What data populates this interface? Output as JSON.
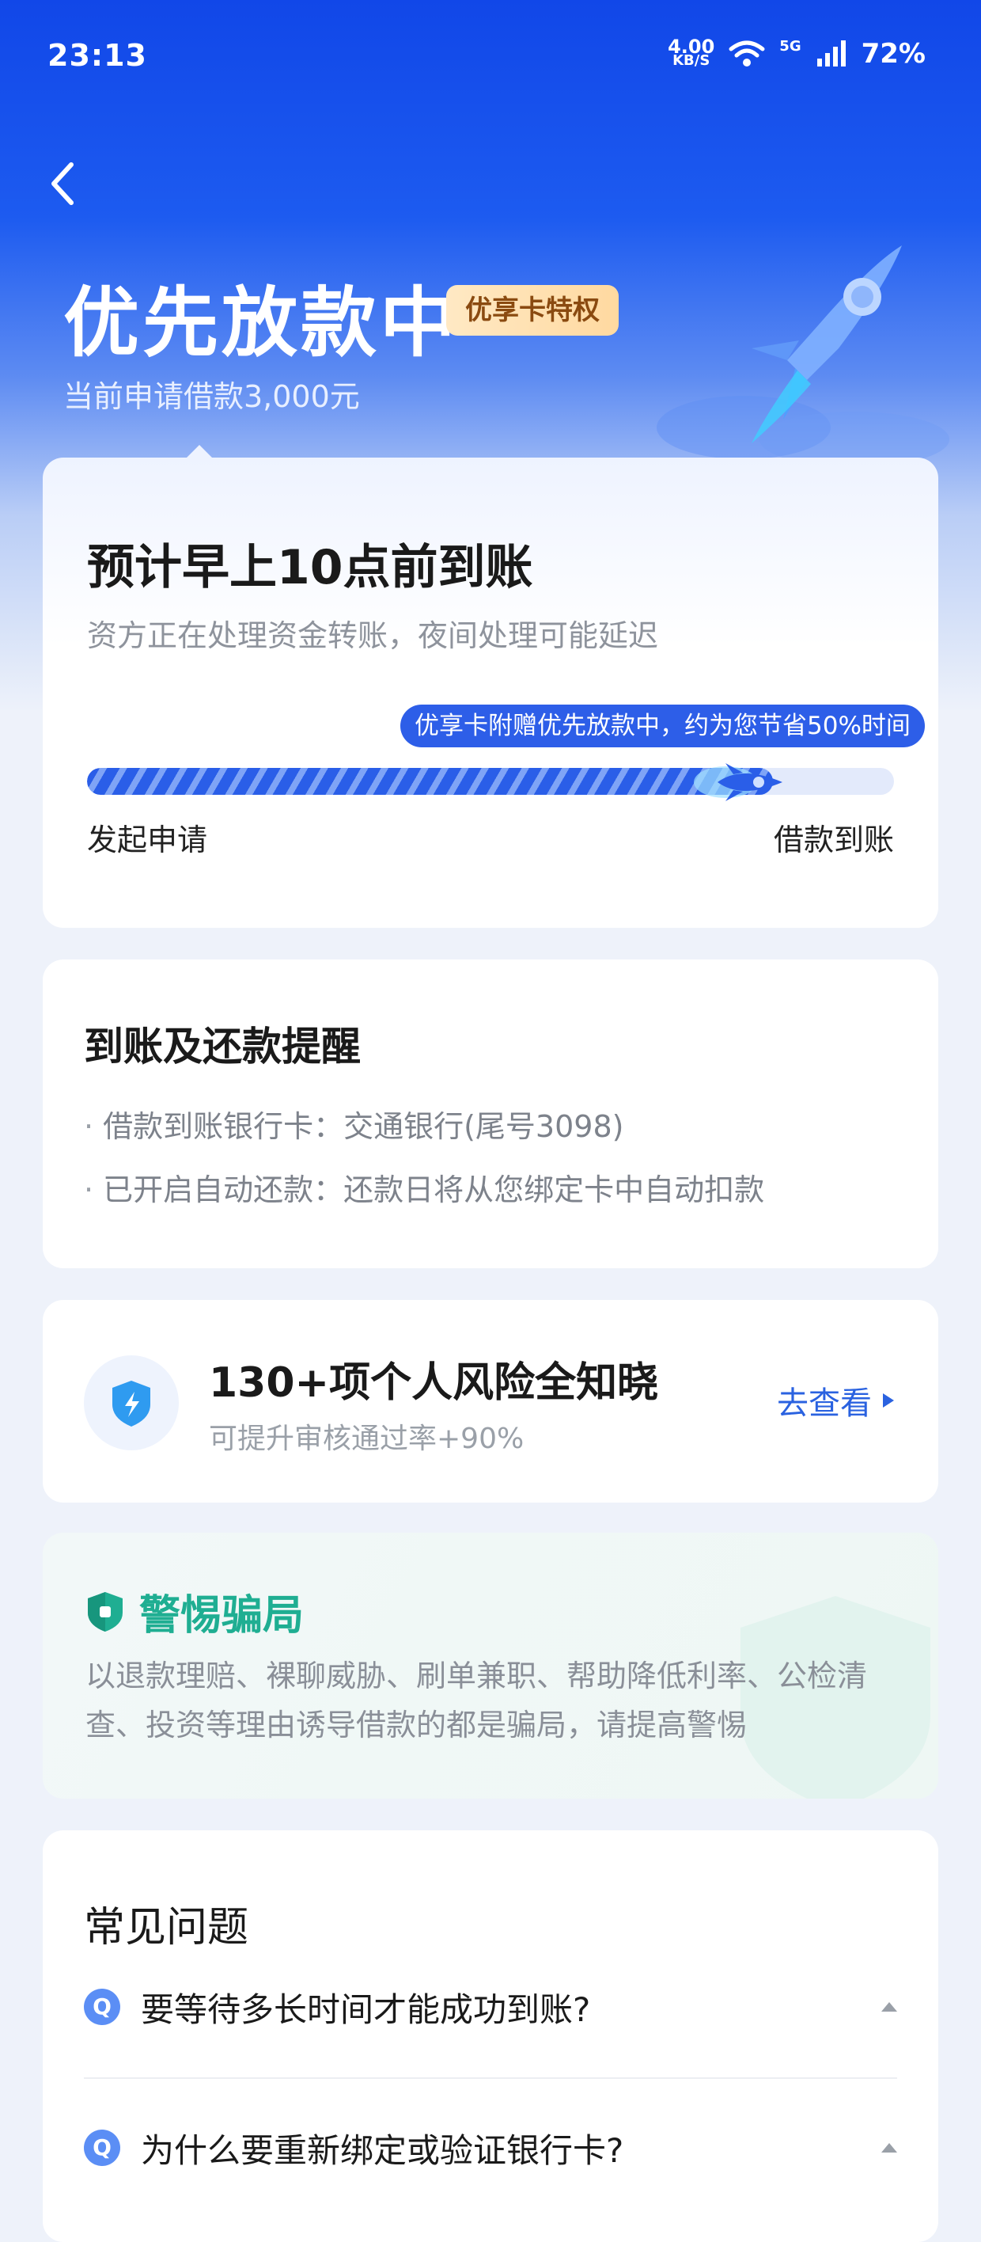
{
  "status_bar": {
    "time": "23:13",
    "net_speed": "4.00",
    "net_unit": "KB/S",
    "network": "5G",
    "battery": "72%"
  },
  "header": {
    "title": "优先放款中",
    "badge": "优享卡特权",
    "subtitle": "当前申请借款3,000元"
  },
  "progress_card": {
    "eta": "预计早上10点前到账",
    "note": "资方正在处理资金转账，夜间处理可能延迟",
    "tip": "优享卡附赠优先放款中，约为您节省50%时间",
    "progress": 0.85,
    "start_label": "发起申请",
    "end_label": "借款到账"
  },
  "reminder_card": {
    "title": "到账及还款提醒",
    "items": [
      "借款到账银行卡：交通银行(尾号3098)",
      "已开启自动还款：还款日将从您绑定卡中自动扣款"
    ]
  },
  "risk_card": {
    "title": "130+项个人风险全知晓",
    "subtitle": "可提升审核通过率+90%",
    "link": "去查看"
  },
  "fraud_card": {
    "title": "警惕骗局",
    "text": "以退款理赔、裸聊威胁、刷单兼职、帮助降低利率、公检清查、投资等理由诱导借款的都是骗局，请提高警惕"
  },
  "faq": {
    "title": "常见问题",
    "badge": "Q",
    "items": [
      "要等待多长时间才能成功到账?",
      "为什么要重新绑定或验证银行卡?"
    ]
  },
  "colors": {
    "brand_blue": "#1147e8",
    "accent_blue": "#2a62e0",
    "fraud_green": "#1fae92",
    "badge_gold": "#ffd9a0"
  }
}
